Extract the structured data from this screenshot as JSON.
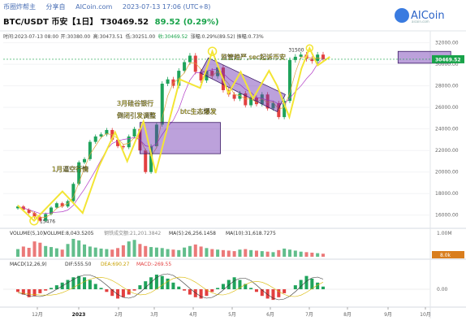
{
  "header": {
    "breadcrumb": "币圈炸帮主",
    "share": "分享自",
    "share_site": "AICoin.com",
    "datetime": "2023-07-13 17:06 (UTC+8)",
    "pair": "BTC/USDT 币安【1日】",
    "price": "T30469.52",
    "change": "89.52 (0.29%)"
  },
  "logo": {
    "name": "AICoin",
    "sub": "aicoin.com"
  },
  "ohlc_line": {
    "time": "时间:2023-07-13 08:00",
    "open": "开:30380.00",
    "high": "高:30473.51",
    "low": "低:30251.00",
    "close": "收:30469.52",
    "change": "涨幅:0.29%(89.52)",
    "amplitude": "振幅:0.73%"
  },
  "chart_data": [
    {
      "type": "line",
      "name": "price",
      "y_ticks": [
        "32000.00",
        "30000.00",
        "28000.00",
        "26000.00",
        "24000.00",
        "22000.00",
        "20000.00",
        "18000.00",
        "16000.00"
      ],
      "x_ticks": [
        "12月",
        "2023",
        "2月",
        "3月",
        "4月",
        "5月",
        "6月",
        "7月",
        "8月",
        "9月",
        "10月"
      ],
      "ylim": [
        15000,
        32500
      ],
      "current_price_label": "30469.52",
      "markers": {
        "low": "15476",
        "high": "31500"
      },
      "close_series": [
        16800,
        16500,
        16200,
        15800,
        15476,
        16100,
        16700,
        17100,
        16800,
        17300,
        18900,
        20900,
        21200,
        22800,
        23300,
        23500,
        23900,
        23000,
        22400,
        22300,
        23300,
        24000,
        22000,
        20000,
        22400,
        24400,
        28200,
        28600,
        28000,
        29400,
        30200,
        30800,
        29300,
        28500,
        29400,
        28900,
        29700,
        27600,
        27200,
        26800,
        27300,
        26200,
        26900,
        26300,
        27200,
        25900,
        26400,
        25100,
        26600,
        30400,
        30700,
        30900,
        30500,
        30300,
        30900,
        30469.52
      ],
      "zigzag": [
        [
          0,
          16900
        ],
        [
          4,
          15476
        ],
        [
          11,
          18200
        ],
        [
          16,
          16200
        ],
        [
          20,
          20500
        ],
        [
          24,
          23700
        ],
        [
          27,
          21000
        ],
        [
          31,
          24700
        ],
        [
          34,
          19900
        ],
        [
          40,
          28600
        ],
        [
          45,
          27800
        ],
        [
          48,
          31200
        ],
        [
          52,
          27300
        ],
        [
          55,
          29300
        ],
        [
          58,
          26800
        ],
        [
          62,
          29400
        ],
        [
          64,
          28000
        ],
        [
          67,
          25100
        ],
        [
          70,
          29600
        ],
        [
          72,
          31500
        ],
        [
          74,
          29900
        ],
        [
          77,
          30700
        ]
      ],
      "annotations": [
        "1月逼空行情",
        "3月硅谷银行",
        "倒闭引发调整",
        "btc生态爆发",
        "监管趋严,sec起诉币安"
      ]
    },
    {
      "type": "bar",
      "name": "volume",
      "legend": {
        "volume": "VOLUME(5,10)",
        "v": "VOLUME:8,043.5205",
        "ma5": "MA(5):26,256.1458",
        "ma10": "MA(10):31,618.7275",
        "extra": "钢铁成交额:21,201.3842"
      },
      "y_ticks": [
        "1.00M",
        "8.0k"
      ],
      "values": [
        30,
        40,
        35,
        60,
        55,
        42,
        38,
        33,
        28,
        50,
        70,
        64,
        48,
        40,
        36,
        32,
        30,
        28,
        34,
        45,
        60,
        66,
        50,
        42,
        38,
        36,
        34,
        30,
        28,
        26,
        36,
        42,
        48,
        40,
        34,
        30,
        28,
        26,
        24,
        22,
        28,
        30,
        26,
        24,
        22,
        20,
        18,
        26,
        32,
        28,
        24,
        20,
        18,
        16,
        14,
        12
      ]
    },
    {
      "type": "bar",
      "name": "macd",
      "legend": {
        "params": "MACD(12,26,9)",
        "dif": "DIF:555.50",
        "dea": "DEA:690.27",
        "macd": "MACD:-269.55"
      },
      "y_ticks": [
        "0.00"
      ],
      "values": [
        -4,
        -8,
        -12,
        -10,
        -6,
        -2,
        2,
        6,
        10,
        14,
        18,
        20,
        18,
        14,
        8,
        2,
        -4,
        -10,
        -14,
        -12,
        -8,
        -2,
        6,
        12,
        18,
        22,
        20,
        16,
        10,
        4,
        -2,
        -8,
        -12,
        -14,
        -10,
        -4,
        2,
        8,
        14,
        18,
        14,
        8,
        2,
        -4,
        -10,
        -14,
        -16,
        -12,
        -6,
        0,
        6,
        14,
        20,
        16,
        10,
        4
      ]
    }
  ],
  "colors": {
    "up": "#1fa35b",
    "down": "#e34040",
    "zigzag": "#f3e534",
    "box": "#6b2fb0",
    "accent": "#2b63c7"
  }
}
